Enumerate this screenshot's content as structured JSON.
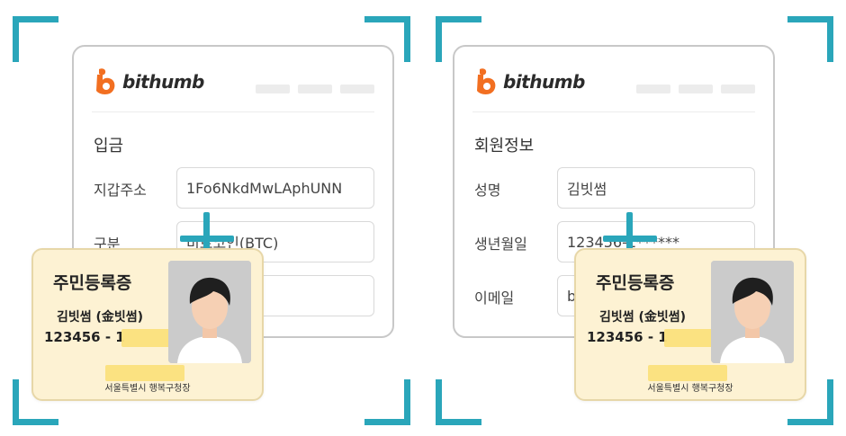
{
  "colors": {
    "accent": "#2aa6ba",
    "brand_orange": "#f26f21",
    "id_card_bg": "#fdf2d3",
    "highlight": "#fbe07c"
  },
  "icons": [
    "frame-corner-icon",
    "plus-icon",
    "bithumb-logo-icon",
    "person-photo-icon"
  ],
  "left": {
    "brand": "bithumb",
    "section_title": "입금",
    "rows": [
      {
        "label": "지갑주소",
        "value": "1Fo6NkdMwLAphUNN"
      },
      {
        "label": "구분",
        "value": "비트코인(BTC)"
      },
      {
        "label": "",
        "value": ""
      }
    ],
    "id_card": {
      "title": "주민등록증",
      "name": "김빗썸 (金빗썸)",
      "number": "123456 - 1",
      "issuer": "서울특별시 행복구청장"
    }
  },
  "right": {
    "brand": "bithumb",
    "section_title": "회원정보",
    "rows": [
      {
        "label": "성명",
        "value": "김빗썸"
      },
      {
        "label": "생년월일",
        "value": "123456-1******"
      },
      {
        "label": "이메일",
        "value": "b"
      }
    ],
    "id_card": {
      "title": "주민등록증",
      "name": "김빗썸 (金빗썸)",
      "number": "123456 - 1",
      "issuer": "서울특별시 행복구청장"
    }
  }
}
